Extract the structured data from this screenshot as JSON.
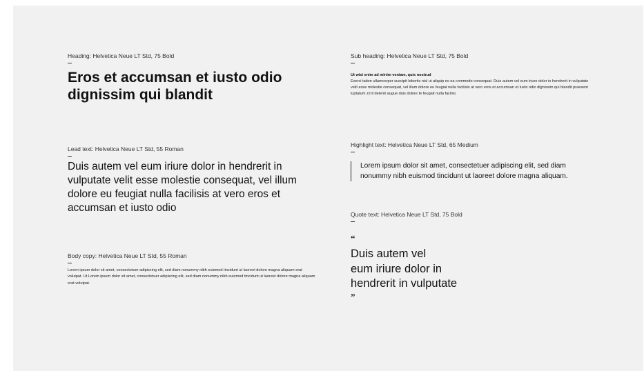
{
  "heading": {
    "label": "Heading: Helvetica Neue LT Std, 75 Bold",
    "text": "Eros et accumsan et iusto odio dignissim qui blandit"
  },
  "lead": {
    "label": "Lead text: Helvetica Neue LT Std, 55 Roman",
    "text": "Duis autem vel eum iriure dolor in hendrerit in vulputate velit esse molestie consequat, vel illum dolore eu feugiat nulla facilisis at vero eros et accumsan et iusto odio"
  },
  "body": {
    "label": "Body copy: Helvetica Neue LT Std, 55 Roman",
    "text": "Lorem ipsum dolor sit amet, consectetuer adipiscing elit, sed diam nonummy nibh euismod tincidunt ut laoreet dolore magna aliquam erat volutpat. Ut Lorem ipsum dolor sit amet, consectetuer adipiscing elit, sed diam nonummy nibh euismod tincidunt ut laoreet dolore magna aliquam erat volutpat."
  },
  "subheading": {
    "label": "Sub heading: Helvetica Neue LT Std, 75 Bold",
    "title": "Ut wisi enim ad minim veniam, quis nostrud",
    "text": "Exerci tation ullamcorper suscipit lobortis nisl ut aliquip ex ea commodo consequat. Duis autem vel eum iriure dolor in hendrerit in vulputate velit esse molestie consequat, vel illum dolore eu feugiat nulla facilisis at vero eros et accumsan et iusto odio dignissim qui blandit praesent luptatum zzril delenit augue duis dolore te feugait nulla facilisi."
  },
  "highlight": {
    "label": "Highlight text: Helvetica Neue LT Std, 65 Medium",
    "text": "Lorem ipsum dolor sit amet, consectetuer adipiscing elit, sed diam nonummy nibh euismod tincidunt ut laoreet dolore magna aliquam."
  },
  "quote": {
    "label": "Quote text: Helvetica Neue LT Std, 75 Bold",
    "open_mark": "“",
    "lines": [
      "Duis autem vel",
      "eum iriure dolor in",
      "hendrerit in vulputate"
    ],
    "close_mark": "”"
  },
  "colors": {
    "panel_background": "#f1f1f1",
    "text": "#111111"
  }
}
